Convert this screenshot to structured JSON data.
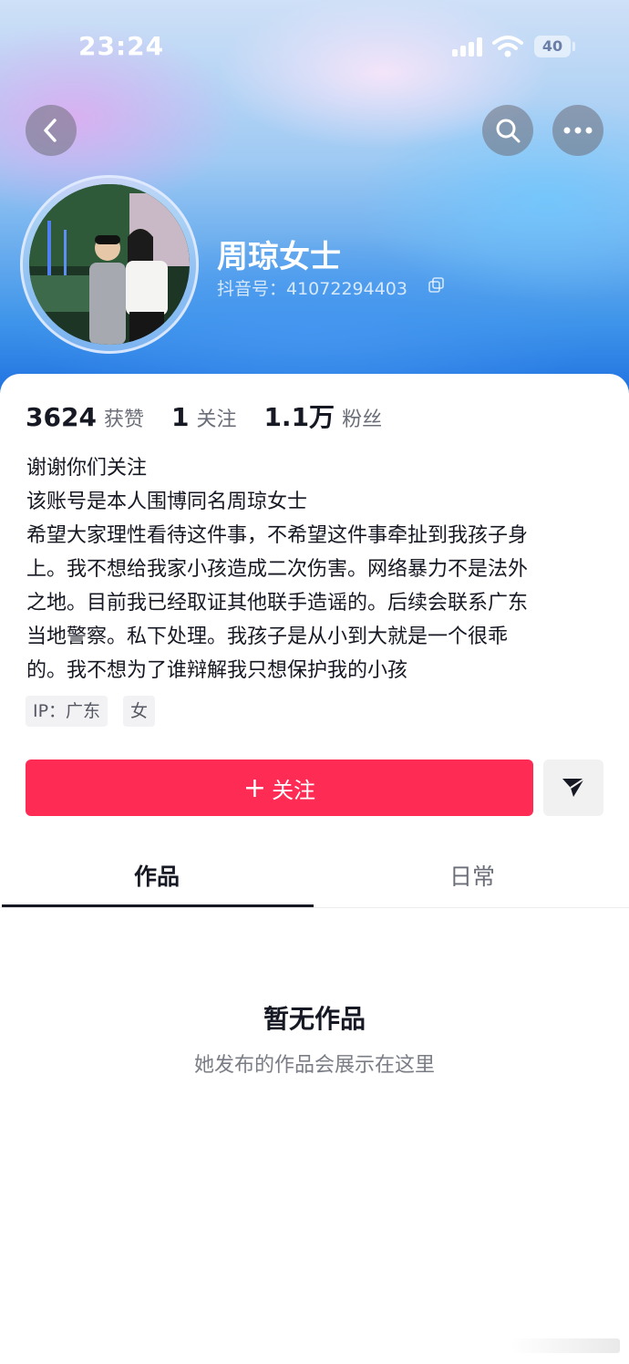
{
  "status_bar": {
    "time": "23:24",
    "battery": "40"
  },
  "profile": {
    "name": "周琼女士",
    "douyin_id": "抖音号：41072294403"
  },
  "stats": [
    {
      "value": "3624",
      "label": "获赞"
    },
    {
      "value": "1",
      "label": "关注"
    },
    {
      "value": "1.1万",
      "label": "粉丝"
    }
  ],
  "bio_lines": [
    "谢谢你们关注",
    "该账号是本人围博同名周琼女士",
    "希望大家理性看待这件事，不希望这件事牵扯到我孩子身",
    "上。我不想给我家小孩造成二次伤害。网络暴力不是法外",
    "之地。目前我已经取证其他联手造谣的。后续会联系广东",
    "当地警察。私下处理。我孩子是从小到大就是一个很乖",
    "的。我不想为了谁辩解我只想保护我的小孩"
  ],
  "tags": {
    "ip": "IP：广东",
    "gender": "女"
  },
  "actions": {
    "follow_plus": "+",
    "follow_label": "关注"
  },
  "tabs": [
    {
      "label": "作品",
      "active": true
    },
    {
      "label": "日常",
      "active": false
    }
  ],
  "empty_state": {
    "title": "暂无作品",
    "subtitle": "她发布的作品会展示在这里"
  },
  "colors": {
    "accent": "#fe2c55",
    "text": "#161823",
    "muted": "#6b6e78"
  }
}
